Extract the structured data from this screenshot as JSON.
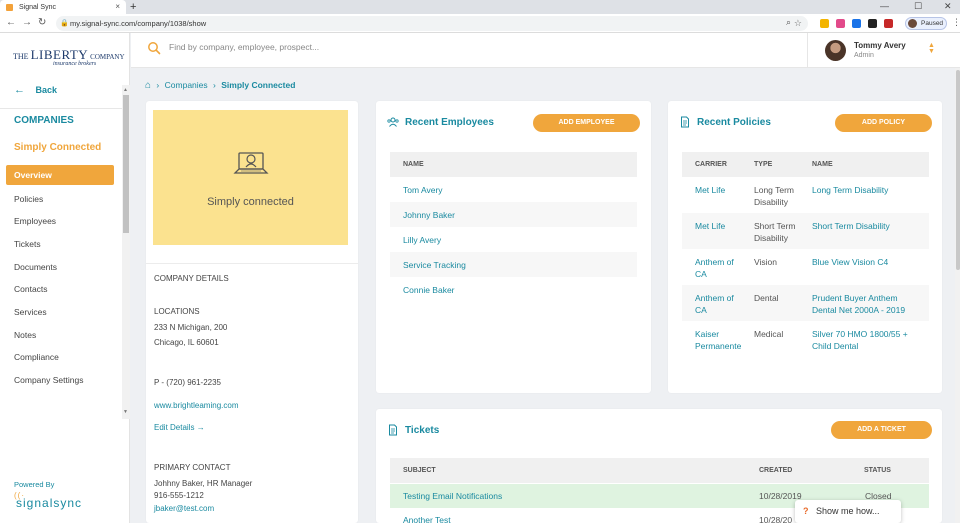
{
  "browser": {
    "tab_title": "Signal Sync",
    "tab_close": "×",
    "new_tab": "+",
    "url": "my.signal-sync.com/company/1038/show",
    "profile_status": "Paused",
    "window_controls": [
      "—",
      "☐",
      "✕"
    ]
  },
  "sidebar": {
    "logo": {
      "the": "THE",
      "liberty": "LIBERTY",
      "company": "COMPANY",
      "sub": "insurance brokers"
    },
    "back_label": "Back",
    "section_title": "COMPANIES",
    "company_name": "Simply Connected",
    "active_item": "Overview",
    "items": [
      "Policies",
      "Employees",
      "Tickets",
      "Documents",
      "Contacts",
      "Services",
      "Notes",
      "Compliance",
      "Company Settings"
    ],
    "powered_by": "Powered By",
    "brand": "signalsync"
  },
  "header": {
    "search_placeholder": "Find by company, employee, prospect...",
    "user_name": "Tommy Avery",
    "user_role": "Admin"
  },
  "breadcrumb": {
    "items": [
      "Companies",
      "Simply Connected"
    ]
  },
  "company_panel": {
    "image_text": "Simply connected",
    "details_label": "COMPANY DETAILS",
    "locations_label": "LOCATIONS",
    "address_line1": "233 N Michigan, 200",
    "address_line2": "Chicago, IL 60601",
    "phone": "P - (720) 961-2235",
    "website": "www.brightleaming.com",
    "edit_details": "Edit Details",
    "primary_contact_label": "PRIMARY CONTACT",
    "contact_name": "Johhny Baker, HR Manager",
    "contact_phone": "916-555-1212",
    "contact_email": "jbaker@test.com"
  },
  "employees": {
    "title": "Recent Employees",
    "add_button": "ADD EMPLOYEE",
    "column": "NAME",
    "rows": [
      "Tom Avery",
      "Johnny Baker",
      "Lilly Avery",
      "Service Tracking",
      "Connie Baker"
    ]
  },
  "policies": {
    "title": "Recent Policies",
    "add_button": "ADD POLICY",
    "columns": [
      "CARRIER",
      "TYPE",
      "NAME"
    ],
    "rows": [
      {
        "carrier": [
          "Met Life",
          ""
        ],
        "type": [
          "Long Term",
          "Disability"
        ],
        "name": [
          "Long Term Disability",
          ""
        ]
      },
      {
        "carrier": [
          "Met Life",
          ""
        ],
        "type": [
          "Short Term",
          "Disability"
        ],
        "name": [
          "Short Term Disability",
          ""
        ]
      },
      {
        "carrier": [
          "Anthem of",
          "CA"
        ],
        "type": [
          "Vision",
          ""
        ],
        "name": [
          "Blue View Vision C4",
          ""
        ]
      },
      {
        "carrier": [
          "Anthem of",
          "CA"
        ],
        "type": [
          "Dental",
          ""
        ],
        "name": [
          "Prudent Buyer Anthem",
          "Dental Net 2000A - 2019"
        ]
      },
      {
        "carrier": [
          "Kaiser",
          "Permanente"
        ],
        "type": [
          "Medical",
          ""
        ],
        "name": [
          "Silver 70 HMO 1800/55 +",
          "Child Dental"
        ]
      }
    ]
  },
  "tickets": {
    "title": "Tickets",
    "add_button": "ADD A TICKET",
    "columns": [
      "SUBJECT",
      "CREATED",
      "STATUS"
    ],
    "rows": [
      {
        "subject": "Testing Email Notifications",
        "created": "10/28/2019",
        "status": "Closed"
      },
      {
        "subject": "Another Test",
        "created": "10/28/20",
        "status": ""
      }
    ]
  },
  "help": {
    "label": "Show me how..."
  },
  "colors": {
    "accent": "#f0a63c",
    "teal": "#1a8aa0",
    "highlight_row": "#dff3e0"
  }
}
